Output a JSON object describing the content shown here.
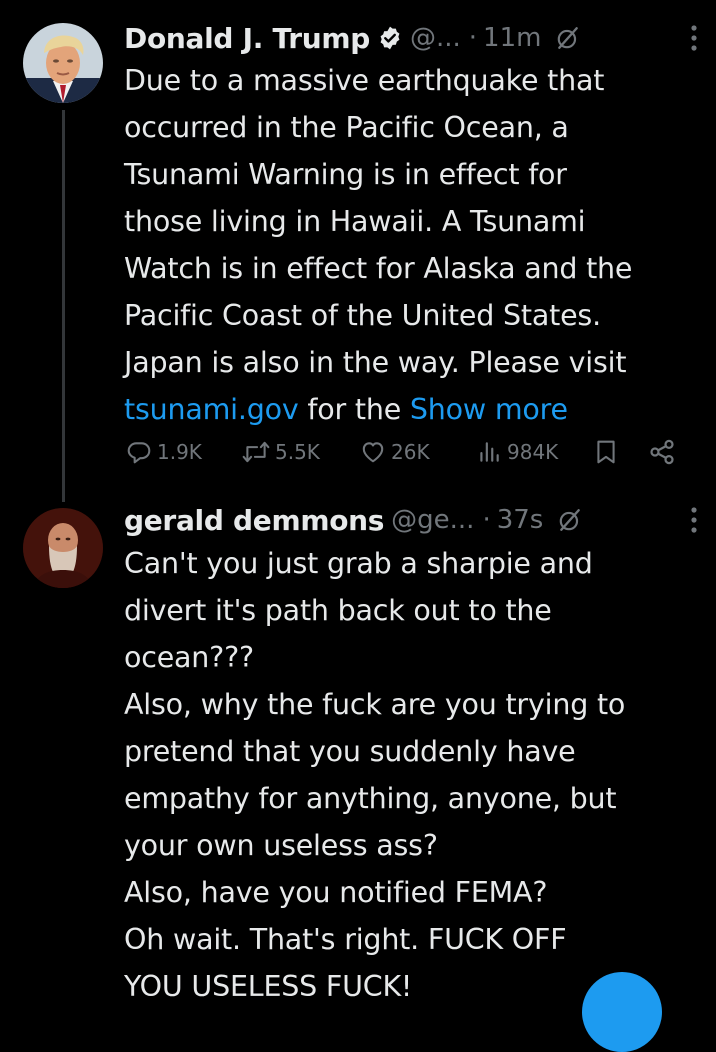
{
  "colors": {
    "background": "#000000",
    "text": "#e7e9ea",
    "muted": "#71767b",
    "link": "#1d9bf0",
    "thread_line": "#333639"
  },
  "post1": {
    "display_name": "Donald J. Trump",
    "verified": true,
    "handle": "@...",
    "dot": "·",
    "timestamp": "11m",
    "lines": [
      "Due to a massive earthquake that",
      "occurred in the Pacific Ocean, a",
      "Tsunami Warning is in effect for",
      "those living in Hawaii. A Tsunami",
      "Watch is in effect for Alaska and the",
      "Pacific Coast of the United States.",
      "Japan is also in the way. Please visit"
    ],
    "last_line": {
      "link": "tsunami.gov",
      "text": " for the ",
      "show_more": "Show more"
    },
    "actions": {
      "replies": "1.9K",
      "reposts": "5.5K",
      "likes": "26K",
      "views": "984K"
    }
  },
  "post2": {
    "display_name": "gerald demmons",
    "handle": "@ge...",
    "dot": "·",
    "timestamp": "37s",
    "lines": [
      "Can't you just grab a sharpie and",
      "divert it's path back out to the",
      "ocean???",
      "Also, why the fuck are you trying to",
      "pretend that you suddenly have",
      "empathy for anything, anyone, but",
      "your own useless ass?",
      "Also, have you notified FEMA?",
      "Oh wait.  That's right. FUCK OFF",
      "YOU USELESS FUCK!"
    ]
  },
  "icons": {
    "verified": "verified-badge-icon",
    "grok": "grok-icon",
    "more": "more-vertical-icon",
    "reply": "reply-icon",
    "repost": "repost-icon",
    "like": "heart-icon",
    "views": "views-icon",
    "bookmark": "bookmark-icon",
    "share": "share-icon",
    "compose": "compose-icon"
  }
}
